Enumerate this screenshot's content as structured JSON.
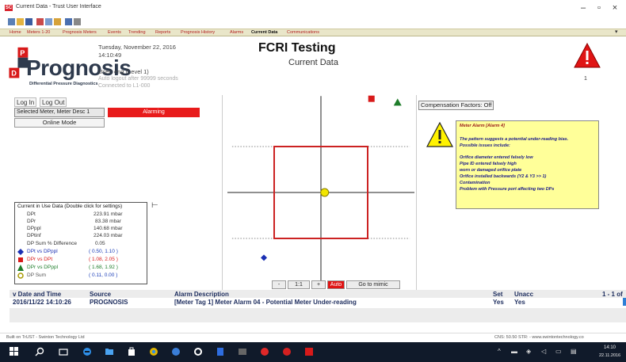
{
  "window": {
    "title": "Current Data - Trust User Interface",
    "minimize_glyph": "–",
    "maximize_glyph": "▫",
    "close_glyph": "×"
  },
  "menu": {
    "tabs": [
      {
        "label": "Home"
      },
      {
        "label": "Meters 1-20"
      },
      {
        "label": "Prognosis Meters"
      },
      {
        "label": "Events"
      },
      {
        "label": "Trending"
      },
      {
        "label": "Reports"
      },
      {
        "label": "Prognosis History"
      },
      {
        "label": "Alarms"
      },
      {
        "label": "Current Data",
        "active": true
      },
      {
        "label": "Communications"
      }
    ],
    "chevron": "▾"
  },
  "header": {
    "logo_text": "Prognosis",
    "logo_subtitle": "Differential Pressure Diagnostics",
    "date": "Tuesday, November 22, 2016",
    "time": "14:10:49",
    "user": "User: eng (Level 1)",
    "auto_logout": "Auto logout after 99999 seconds",
    "connection": "Connected to L1-000",
    "title": "FCRI Testing",
    "subtitle": "Current Data",
    "alarm_count": "1"
  },
  "left_panel": {
    "login_label": "Log In",
    "logout_label": "Log Out",
    "meter_select": "Selected Meter, Meter Desc 1",
    "alarm_status": "Alarming",
    "mode_button": "Online Mode"
  },
  "data_panel": {
    "title": "Current in Use Data (Double click for settings)",
    "rows": [
      {
        "label": "DPt",
        "value": "223.91 mbar"
      },
      {
        "label": "DPr",
        "value": "83.38 mbar"
      },
      {
        "label": "DPppl",
        "value": "140.68 mbar"
      },
      {
        "label": "DPtinf",
        "value": "224.03 mbar"
      },
      {
        "label": "DP Sum % Difference",
        "value": "0.05"
      }
    ],
    "legend": [
      {
        "label": "DPt vs DPppl",
        "range": "( 0.50, 1.10 )",
        "color": "#1a2fb3",
        "shape": "diamond"
      },
      {
        "label": "DPr vs DPt",
        "range": "( 1.08, 2.05 )",
        "color": "#d81a1a",
        "shape": "square"
      },
      {
        "label": "DPr vs DPppl",
        "range": "( 1.68, 1.92 )",
        "color": "#1e7d2a",
        "shape": "triangle"
      },
      {
        "label": "DP Sum",
        "range": "( 0.11, 0.00 )",
        "color": "#d6c800",
        "shape": "circle"
      }
    ],
    "arrow": "⊢"
  },
  "chart_controls": {
    "minus": "-",
    "ratio": "1:1",
    "plus": "+",
    "auto": "Auto",
    "mimic": "Go to mimic"
  },
  "right_panel": {
    "compensation": "Compensation Factors: Off",
    "alarm_note": {
      "title": "Meter Alarm [Alarm 4]",
      "lines": [
        "The pattern suggests a potential under-reading bias.",
        "Possible issues include:",
        "",
        "Orifice diameter entered falsely low",
        "Pipe ID entered falsely high",
        "worn or damaged orifice plate",
        "Orifice installed backwards (Y2 & Y3 >> 1)",
        "Contamination",
        "Problem with Pressure port affecting two DPs"
      ]
    }
  },
  "alarm_table": {
    "headers": {
      "date": "v Date and Time",
      "source": "Source",
      "description": "Alarm Description",
      "set": "Set",
      "unack": "Unacc",
      "paging": "1 - 1 of"
    },
    "rows": [
      {
        "date": "2016/11/22 14:10:26",
        "source": "PROGNOSIS",
        "description": "[Meter Tag 1] Meter Alarm 04 - Potential Meter Under-reading",
        "set": "Yes",
        "unack": "Yes"
      }
    ]
  },
  "statusbar": {
    "left": "Built on TrUST - Swinton Technology Ltd",
    "right": "CNS: 50.50  STR: - www.swintontechnology.co"
  },
  "taskbar": {
    "time": "14:10",
    "date": "22.11.2016"
  },
  "colors": {
    "alarm_red": "#d81a1a",
    "box_red": "#cc2222",
    "note_yellow": "#ffff99",
    "brand_navy": "#2e3a4d"
  },
  "chart_data": {
    "type": "scatter",
    "title": "",
    "points": [
      {
        "name": "DPt vs DPppl",
        "shape": "diamond",
        "color": "#1a2fb3",
        "x": -0.61,
        "y": -0.71
      },
      {
        "name": "DPr vs DPt",
        "shape": "square",
        "color": "#d81a1a",
        "x": 0.54,
        "y": 1.02
      },
      {
        "name": "DPr vs DPppl",
        "shape": "triangle",
        "color": "#1e7d2a",
        "x": 0.82,
        "y": 0.98
      },
      {
        "name": "DP Sum",
        "shape": "circle",
        "color": "#d6c800",
        "x": 0.04,
        "y": 0.0
      }
    ],
    "limit_box": {
      "x_range": [
        -0.5,
        0.5
      ],
      "y_range": [
        -0.5,
        0.5
      ]
    },
    "xlim": [
      -1.0,
      1.0
    ],
    "ylim": [
      -1.05,
      1.05
    ],
    "dotted_limit_lines": [
      0.5,
      -0.5
    ],
    "grid": false
  }
}
